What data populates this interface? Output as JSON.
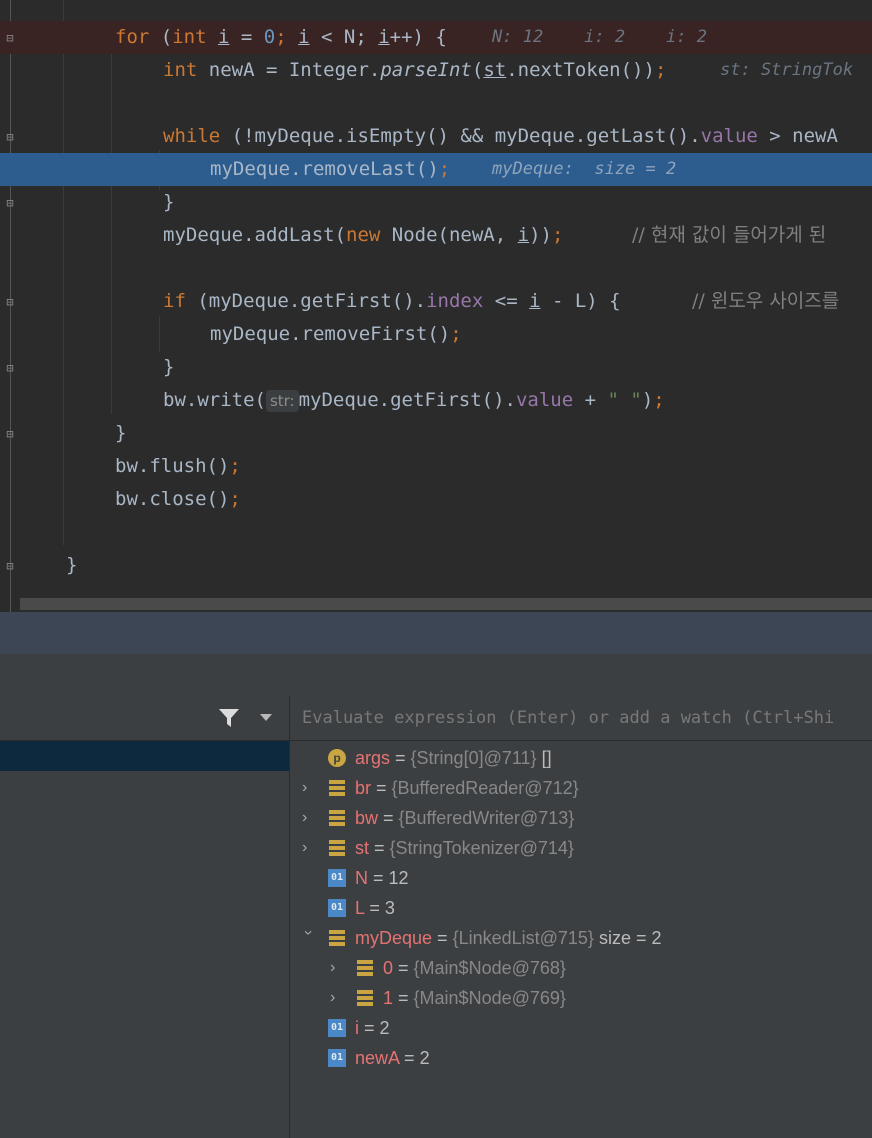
{
  "editor": {
    "lines": {
      "l1": {
        "kw_for": "for",
        "p1": " (",
        "kw_int": "int",
        "v_i": "i",
        "p2": " = ",
        "n0": "0",
        "p3": "; ",
        "v_i2": "i",
        "p4": " < N; ",
        "v_i3": "i",
        "p5": "++) {",
        "hint": "N: 12    i: 2    i: 2"
      },
      "l2": {
        "kw_int": "int",
        "p1": " newA = Integer.",
        "m_parse": "parseInt",
        "p2": "(",
        "v_st": "st",
        "p3": ".nextToken())",
        "semi": ";",
        "hint": "st: StringTok"
      },
      "l3": {
        "kw_while": "while",
        "p1": " (!myDeque.isEmpty() && myDeque.getLast().",
        "f_value": "value",
        "p2": " > newA"
      },
      "l4": {
        "p1": "myDeque.removeLast()",
        "semi": ";",
        "hint": "myDeque:  size = 2"
      },
      "l5": {
        "p1": "}"
      },
      "l6": {
        "p1": "myDeque.addLast(",
        "kw_new": "new",
        "p2": " Node(newA, ",
        "v_i": "i",
        "p3": "))",
        "semi": ";",
        "cmt": "// 현재 값이 들어가게 된"
      },
      "l7": {
        "kw_if": "if",
        "p1": " (myDeque.getFirst().",
        "f_index": "index",
        "p2": " <= ",
        "v_i": "i",
        "p3": " - L) {",
        "cmt": "// 윈도우 사이즈를"
      },
      "l8": {
        "p1": "myDeque.removeFirst()",
        "semi": ";"
      },
      "l9": {
        "p1": "}"
      },
      "l10": {
        "p1": "bw.write(",
        "param_hint": "str:",
        "p2": "myDeque.getFirst().",
        "f_value": "value",
        "p3": " + ",
        "s": "\" \"",
        "p4": ")",
        "semi": ";"
      },
      "l11": {
        "p1": "}"
      },
      "l12": {
        "p1": "bw.flush()",
        "semi": ";"
      },
      "l13": {
        "p1": "bw.close()",
        "semi": ";"
      },
      "l14": {
        "p1": "}"
      }
    }
  },
  "debugger": {
    "eval_placeholder": "Evaluate expression (Enter) or add a watch (Ctrl+Shi",
    "variables": [
      {
        "name": "args",
        "eq": " = ",
        "ref": "{String[0]@711}",
        "val": " []",
        "icon": "parameter-icon"
      },
      {
        "name": "br",
        "eq": " = ",
        "ref": "{BufferedReader@712}",
        "val": "",
        "icon": "object-icon"
      },
      {
        "name": "bw",
        "eq": " = ",
        "ref": "{BufferedWriter@713}",
        "val": "",
        "icon": "object-icon"
      },
      {
        "name": "st",
        "eq": " = ",
        "ref": "{StringTokenizer@714}",
        "val": "",
        "icon": "object-icon"
      },
      {
        "name": "N",
        "eq": " = ",
        "ref": "",
        "val": "12",
        "icon": "primitive-icon"
      },
      {
        "name": "L",
        "eq": " = ",
        "ref": "",
        "val": "3",
        "icon": "primitive-icon"
      },
      {
        "name": "myDeque",
        "eq": " = ",
        "ref": "{LinkedList@715}",
        "val": "  size = 2",
        "icon": "object-icon"
      },
      {
        "name": "0",
        "eq": " = ",
        "ref": "{Main$Node@768}",
        "val": "",
        "icon": "object-icon"
      },
      {
        "name": "1",
        "eq": " = ",
        "ref": "{Main$Node@769}",
        "val": "",
        "icon": "object-icon"
      },
      {
        "name": "i",
        "eq": " = ",
        "ref": "",
        "val": "2",
        "icon": "primitive-icon"
      },
      {
        "name": "newA",
        "eq": " = ",
        "ref": "",
        "val": "2",
        "icon": "primitive-icon"
      }
    ],
    "icons": {
      "primitive_label": "01",
      "parameter_label": "p",
      "filter": "filter-icon",
      "dropdown": "dropdown-icon"
    }
  },
  "colors": {
    "execution_line": "#2d5c8f",
    "breakpoint_line": "#3a2323",
    "keyword": "#cc7832",
    "variable_name": "#e57373"
  }
}
